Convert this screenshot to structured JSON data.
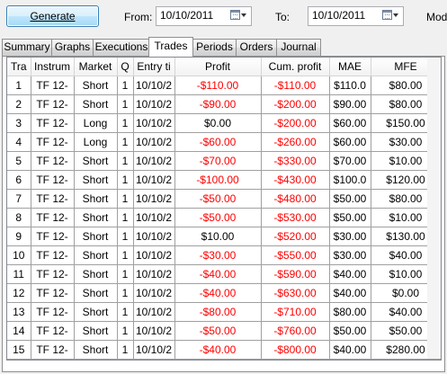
{
  "toolbar": {
    "generate_label": "Generate",
    "from_label": "From:",
    "from_date": "10/10/2011",
    "to_label": "To:",
    "to_date": "10/10/2011",
    "mode_label": "Mode"
  },
  "tabs": [
    {
      "label": "Summary"
    },
    {
      "label": "Graphs"
    },
    {
      "label": "Executions"
    },
    {
      "label": "Trades"
    },
    {
      "label": "Periods"
    },
    {
      "label": "Orders"
    },
    {
      "label": "Journal"
    }
  ],
  "active_tab": "Trades",
  "colors": {
    "negative": "#ff0000"
  },
  "table": {
    "columns": [
      "Tra",
      "Instrum",
      "Market",
      "Q",
      "Entry ti",
      "Profit",
      "Cum. profit",
      "MAE",
      "MFE"
    ],
    "rows": [
      [
        "1",
        "TF 12-",
        "Short",
        "1",
        "10/10/2",
        "-$110.00",
        "-$110.00",
        "$110.0",
        "$80.00"
      ],
      [
        "2",
        "TF 12-",
        "Short",
        "1",
        "10/10/2",
        "-$90.00",
        "-$200.00",
        "$90.00",
        "$80.00"
      ],
      [
        "3",
        "TF 12-",
        "Long",
        "1",
        "10/10/2",
        "$0.00",
        "-$200.00",
        "$60.00",
        "$150.00"
      ],
      [
        "4",
        "TF 12-",
        "Long",
        "1",
        "10/10/2",
        "-$60.00",
        "-$260.00",
        "$60.00",
        "$30.00"
      ],
      [
        "5",
        "TF 12-",
        "Short",
        "1",
        "10/10/2",
        "-$70.00",
        "-$330.00",
        "$70.00",
        "$10.00"
      ],
      [
        "6",
        "TF 12-",
        "Short",
        "1",
        "10/10/2",
        "-$100.00",
        "-$430.00",
        "$100.0",
        "$120.00"
      ],
      [
        "7",
        "TF 12-",
        "Short",
        "1",
        "10/10/2",
        "-$50.00",
        "-$480.00",
        "$50.00",
        "$80.00"
      ],
      [
        "8",
        "TF 12-",
        "Short",
        "1",
        "10/10/2",
        "-$50.00",
        "-$530.00",
        "$50.00",
        "$10.00"
      ],
      [
        "9",
        "TF 12-",
        "Short",
        "1",
        "10/10/2",
        "$10.00",
        "-$520.00",
        "$30.00",
        "$130.00"
      ],
      [
        "10",
        "TF 12-",
        "Short",
        "1",
        "10/10/2",
        "-$30.00",
        "-$550.00",
        "$30.00",
        "$40.00"
      ],
      [
        "11",
        "TF 12-",
        "Short",
        "1",
        "10/10/2",
        "-$40.00",
        "-$590.00",
        "$40.00",
        "$10.00"
      ],
      [
        "12",
        "TF 12-",
        "Short",
        "1",
        "10/10/2",
        "-$40.00",
        "-$630.00",
        "$40.00",
        "$0.00"
      ],
      [
        "13",
        "TF 12-",
        "Short",
        "1",
        "10/10/2",
        "-$80.00",
        "-$710.00",
        "$80.00",
        "$40.00"
      ],
      [
        "14",
        "TF 12-",
        "Short",
        "1",
        "10/10/2",
        "-$50.00",
        "-$760.00",
        "$50.00",
        "$50.00"
      ],
      [
        "15",
        "TF 12-",
        "Short",
        "1",
        "10/10/2",
        "-$40.00",
        "-$800.00",
        "$40.00",
        "$280.00"
      ]
    ]
  }
}
